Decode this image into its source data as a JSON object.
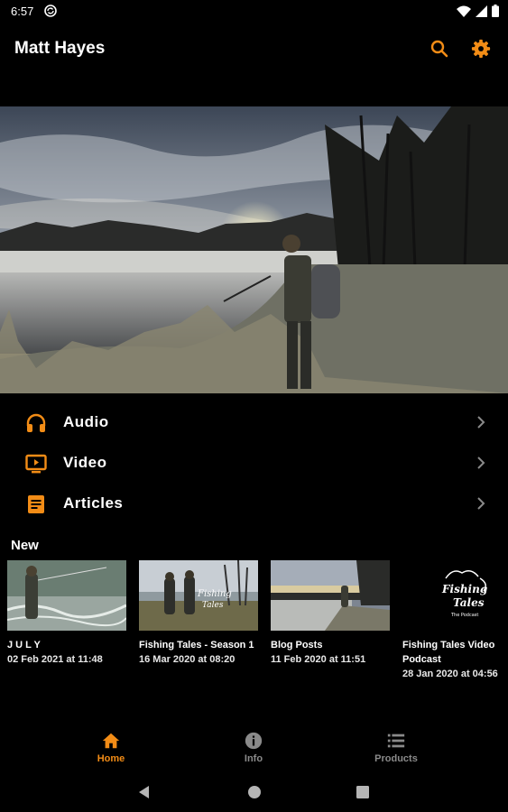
{
  "status_bar": {
    "time": "6:57"
  },
  "app_bar": {
    "title": "Matt Hayes"
  },
  "menu": [
    {
      "label": "Audio",
      "icon": "headphones-icon"
    },
    {
      "label": "Video",
      "icon": "tv-play-icon"
    },
    {
      "label": "Articles",
      "icon": "article-icon"
    }
  ],
  "new_section": {
    "title": "New",
    "cards": [
      {
        "title": "J U L Y",
        "date": "02 Feb 2021 at 11:48"
      },
      {
        "title": "Fishing Tales - Season 1",
        "date": "16 Mar 2020 at 08:20"
      },
      {
        "title": "Blog Posts",
        "date": "11 Feb 2020 at 11:51"
      },
      {
        "title": "Fishing Tales Video Podcast",
        "date": "28 Jan 2020 at 04:56",
        "logo_text": "Fishing Tales The Podcast"
      }
    ]
  },
  "bottom_nav": [
    {
      "label": "Home",
      "icon": "home-icon",
      "active": true
    },
    {
      "label": "Info",
      "icon": "info-icon",
      "active": false
    },
    {
      "label": "Products",
      "icon": "list-icon",
      "active": false
    }
  ],
  "colors": {
    "accent": "#f28c16",
    "inactive": "#8a8a8a",
    "background": "#000000"
  }
}
